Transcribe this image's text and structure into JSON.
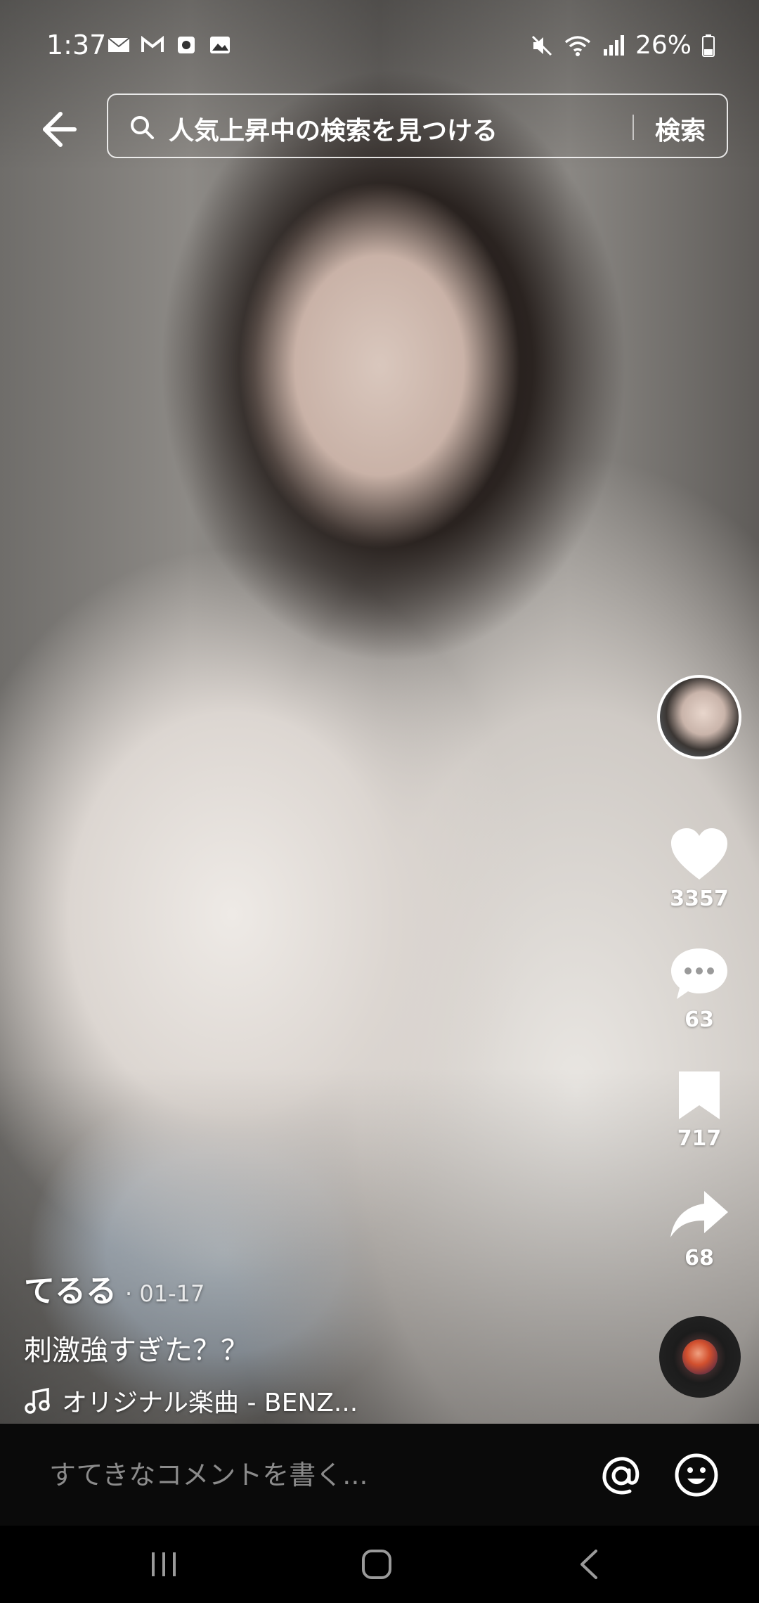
{
  "status_bar": {
    "time": "1:37",
    "battery_percent": "26%",
    "left_icons": [
      "mail-icon",
      "gmail-icon",
      "screen-record-icon",
      "gallery-icon"
    ],
    "right_icons": [
      "mute-icon",
      "wifi-icon",
      "signal-icon",
      "battery-icon"
    ]
  },
  "header": {
    "search_placeholder": "人気上昇中の検索を見つける",
    "search_button": "検索"
  },
  "post": {
    "author": "てるる",
    "date": "· 01-17",
    "description": "刺激強すぎた？？",
    "music": "オリジナル楽曲 - BENZ..."
  },
  "actions": {
    "likes": "3357",
    "comments": "63",
    "bookmarks": "717",
    "shares": "68"
  },
  "comment_bar": {
    "placeholder": "すてきなコメントを書く..."
  },
  "colors": {
    "comment_bar_bg": "#0a0a0a",
    "placeholder_text": "#8b8b8b",
    "icon": "#ffffff"
  }
}
